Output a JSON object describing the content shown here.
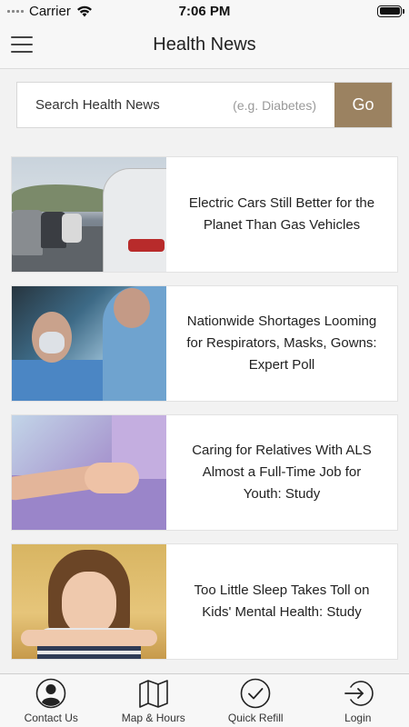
{
  "status_bar": {
    "carrier": "Carrier",
    "time": "7:06 PM"
  },
  "header": {
    "title": "Health News"
  },
  "search": {
    "label": "Search Health News",
    "hint": "(e.g. Diabetes)",
    "button_label": "Go"
  },
  "articles": [
    {
      "title": "Electric Cars Still Better for the Planet Than Gas Vehicles",
      "image": "traffic-cars-photo"
    },
    {
      "title": "Nationwide Shortages Looming for Respirators, Masks, Gowns: Expert Poll",
      "image": "patient-respirator-photo"
    },
    {
      "title": "Caring for Relatives With ALS Almost a Full-Time Job for Youth: Study",
      "image": "holding-hands-photo"
    },
    {
      "title": "Too Little Sleep Takes Toll on Kids' Mental Health: Study",
      "image": "tired-girl-photo"
    }
  ],
  "tab_bar": {
    "items": [
      {
        "label": "Contact Us",
        "icon": "person-icon"
      },
      {
        "label": "Map & Hours",
        "icon": "map-icon"
      },
      {
        "label": "Quick Refill",
        "icon": "checkmark-icon"
      },
      {
        "label": "Login",
        "icon": "login-icon"
      }
    ]
  },
  "colors": {
    "accent": "#9b8261",
    "background": "#f2f2f2"
  }
}
